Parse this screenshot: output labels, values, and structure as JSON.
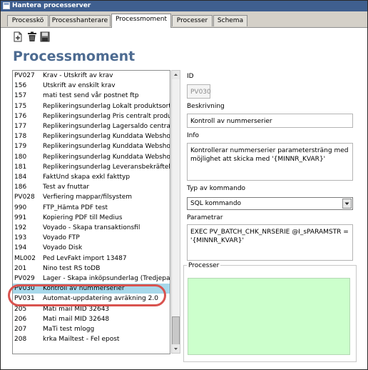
{
  "window": {
    "title": "Hantera processerver",
    "icon": "window-icon"
  },
  "tabs": [
    {
      "label": "Processkö"
    },
    {
      "label": "Processhanterare"
    },
    {
      "label": "Processmoment"
    },
    {
      "label": "Processer"
    },
    {
      "label": "Schema"
    }
  ],
  "active_tab": "Processmoment",
  "toolbar": {
    "buttons": [
      "new-icon",
      "delete-icon",
      "save-icon"
    ]
  },
  "page": {
    "heading": "Processmoment"
  },
  "list": {
    "rows": [
      {
        "id": "PV027",
        "name": "Krav - Utskrift av krav"
      },
      {
        "id": "156",
        "name": "Utskrift av enskilt krav"
      },
      {
        "id": "157",
        "name": "mati test send vår postnet ftp"
      },
      {
        "id": "175",
        "name": "Repliker­ingsunderlag Lokalt produktsortiment"
      },
      {
        "id": "176",
        "name": "Replikeringsunderlag Pris centralt produktsorti"
      },
      {
        "id": "177",
        "name": "Replikeringsunderlag Lagersaldo centralt prod"
      },
      {
        "id": "178",
        "name": "Replikeringsunderlag Kunddata Webshop (Ma"
      },
      {
        "id": "179",
        "name": "Replikeringsunderlag Kunddata Webshop (Ma"
      },
      {
        "id": "180",
        "name": "Replikeringsunderlag Kunddata Webshop (Ma"
      },
      {
        "id": "181",
        "name": "Replikeringsunderlag Leveransbekräftelse We"
      },
      {
        "id": "184",
        "name": "FaktUnd skapa exkl fakttyp"
      },
      {
        "id": "186",
        "name": "Test av fnuttar"
      },
      {
        "id": "PV028",
        "name": "Verfiering mappar/filsystem"
      },
      {
        "id": "990",
        "name": "FTP_Hämta PDF test"
      },
      {
        "id": "991",
        "name": "Kopiering PDF till Medius"
      },
      {
        "id": "192",
        "name": "Voyado - Skapa transaktionsfil"
      },
      {
        "id": "193",
        "name": "Voyado FTP"
      },
      {
        "id": "194",
        "name": "Voyado Disk"
      },
      {
        "id": "ML002",
        "name": "Ped LevFakt import 13487"
      },
      {
        "id": "201",
        "name": "Nino test RS toDB"
      },
      {
        "id": "PV029",
        "name": "Lager - Skapa inköpsunderlag (Tredjepartsavt"
      },
      {
        "id": "PV030",
        "name": "Kontroll av nummerserier"
      },
      {
        "id": "PV031",
        "name": "Automat-uppdatering avräkning 2.0"
      },
      {
        "id": "205",
        "name": "Mati mail MID 32643"
      },
      {
        "id": "206",
        "name": "Mati mail MID 32648"
      },
      {
        "id": "207",
        "name": "MaTi test mlogg"
      },
      {
        "id": "208",
        "name": "krka Mailtest - Fel epost"
      }
    ],
    "selected_id": "PV030"
  },
  "detail": {
    "id_label": "ID",
    "id_value": "PV030",
    "beskrivning_label": "Beskrivning",
    "beskrivning_value": "Kontroll av nummerserier",
    "info_label": "Info",
    "info_value": "Kontrollerar nummerserier parametersträng med möjlighet att skicka med  '{MINNR_KVAR}'",
    "typ_label": "Typ av kommando",
    "typ_value": "SQL kommando",
    "parametrar_label": "Parametrar",
    "parametrar_value": "EXEC PV_BATCH_CHK_NRSERIE @I_sPARAMSTR = '{MINNR_KVAR}'",
    "processer_label": "Processer"
  },
  "colors": {
    "titlebar": "#3f5f8f",
    "heading": "#4d6b91",
    "selected_row": "#a7d8ea",
    "processer_bg": "#ccffcc",
    "callout": "#d9534f"
  }
}
